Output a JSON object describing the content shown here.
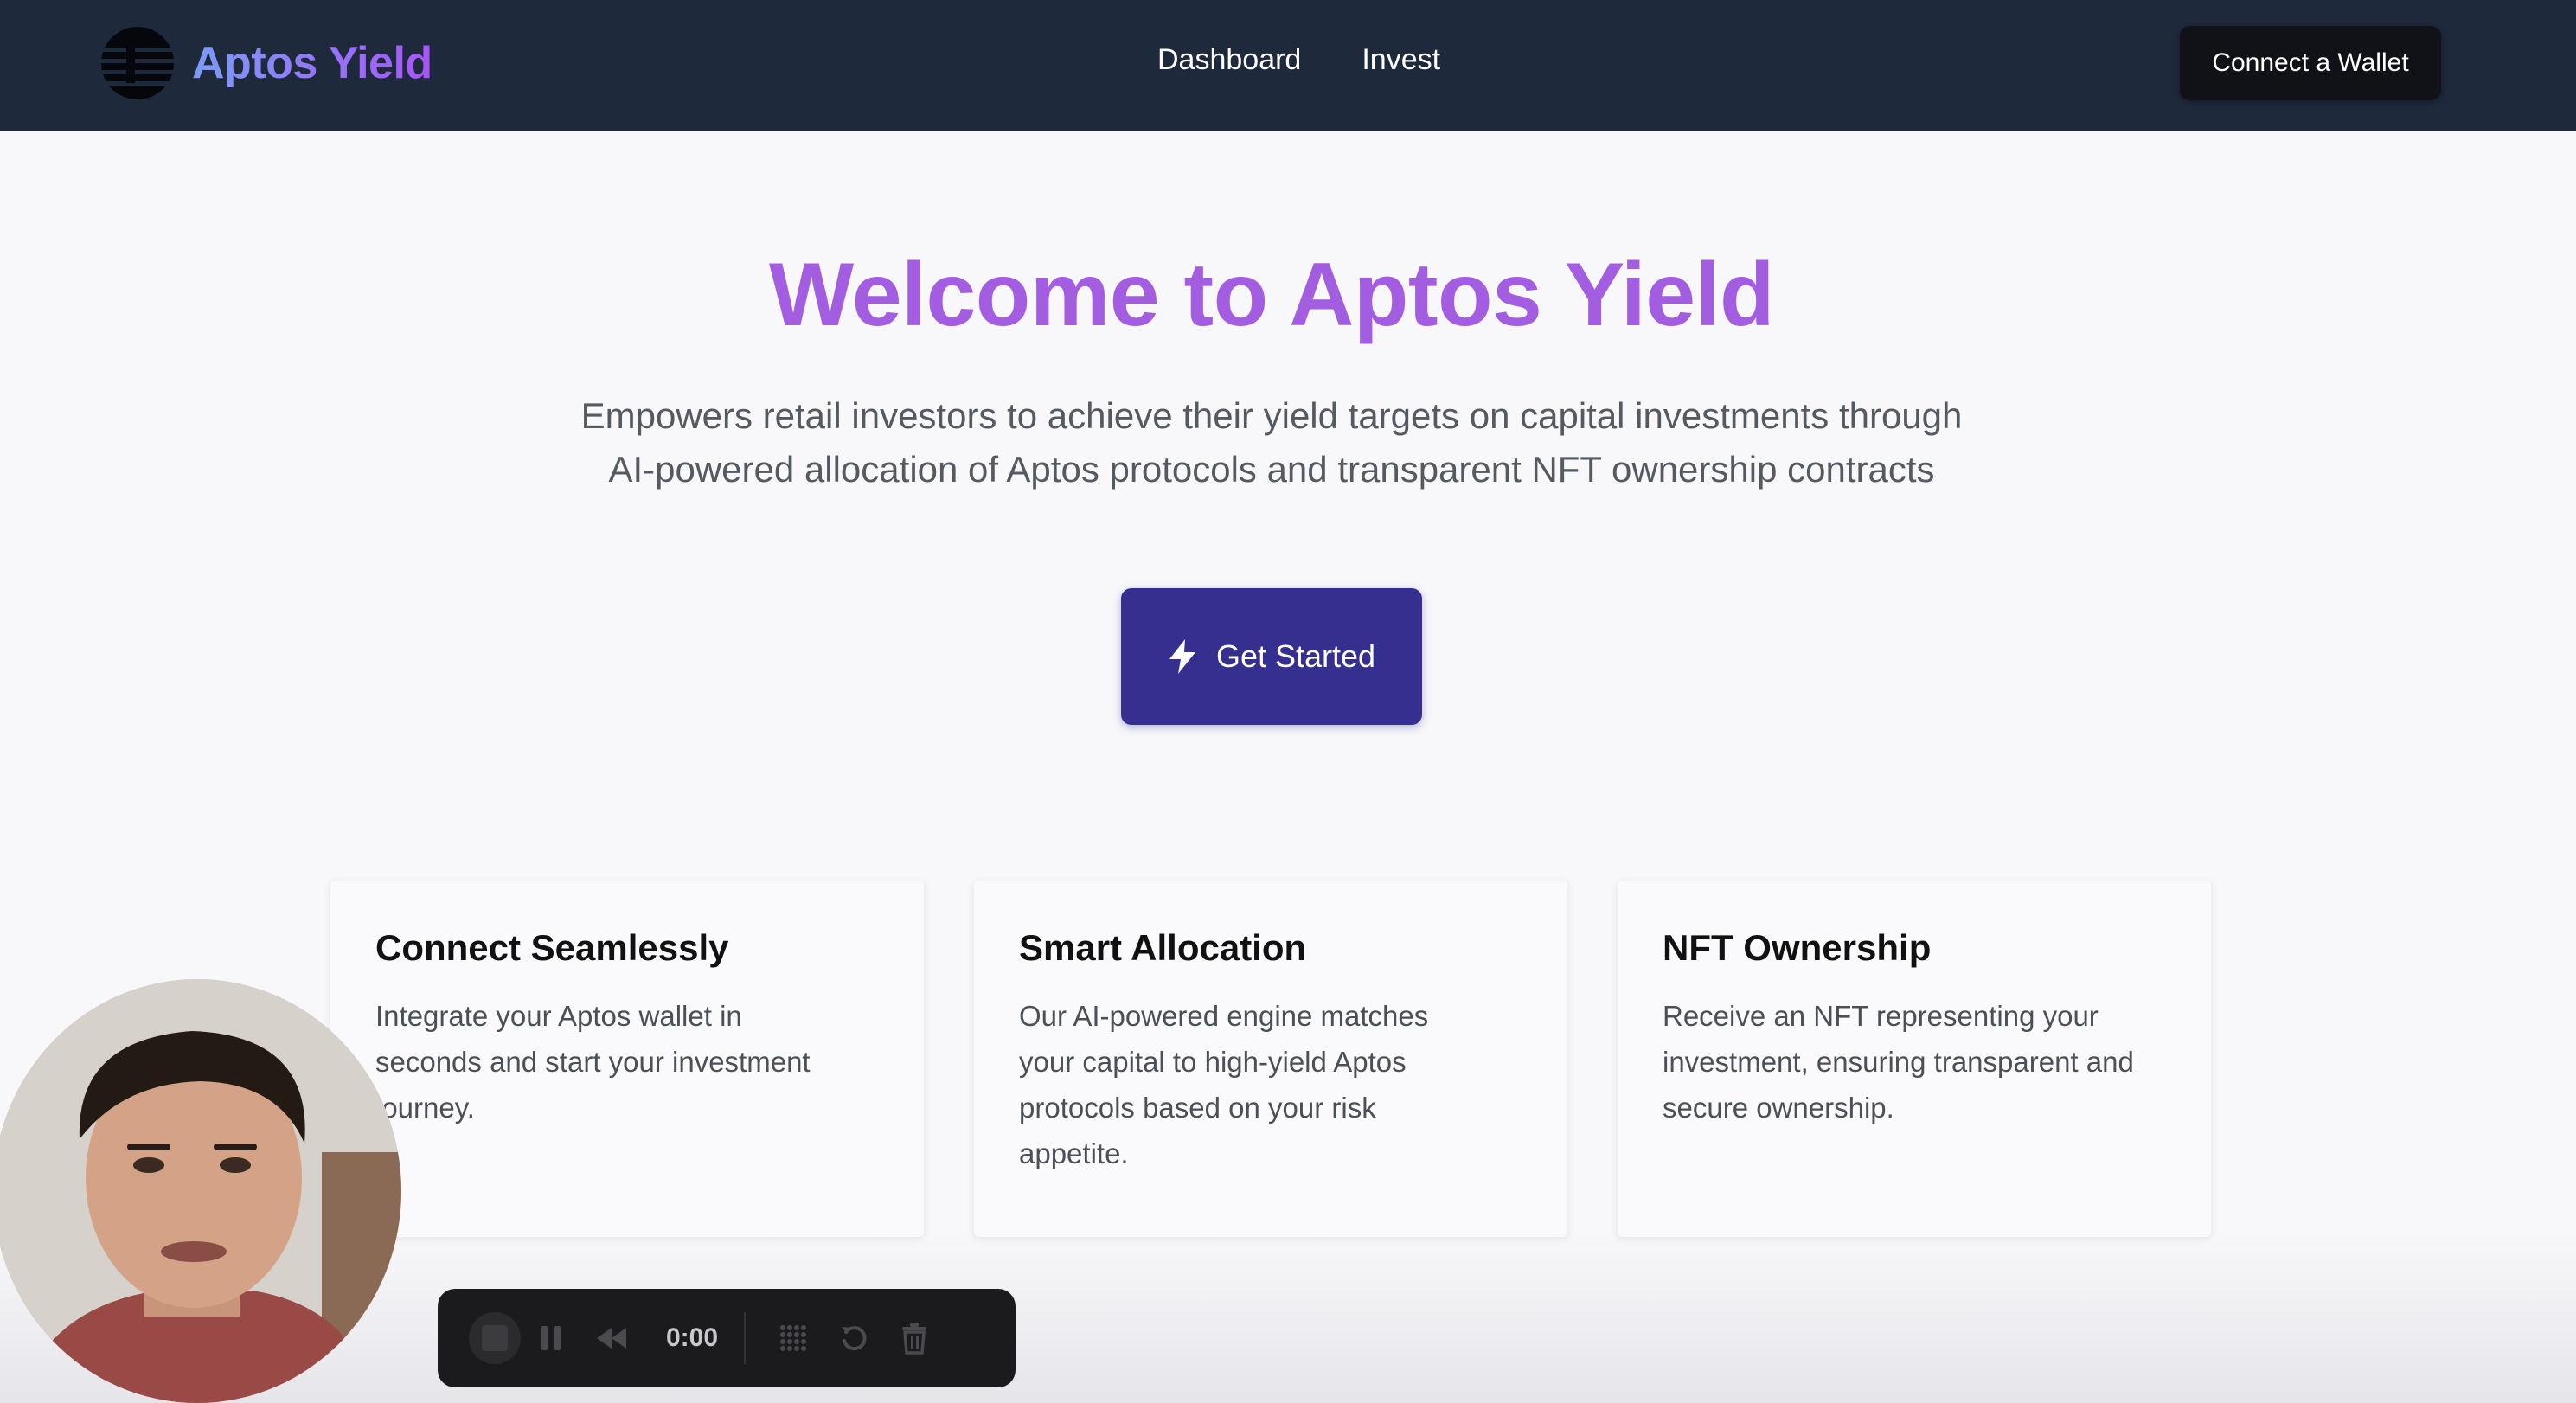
{
  "brand": {
    "name": "Aptos Yield",
    "gradient_start": "#7c9cf5",
    "gradient_end": "#a855f7",
    "logo_icon": "aptos-logo-icon"
  },
  "nav": {
    "links": [
      {
        "label": "Dashboard"
      },
      {
        "label": "Invest"
      }
    ],
    "wallet_button": "Connect a Wallet",
    "background": "#1e293b"
  },
  "hero": {
    "title": "Welcome to Aptos Yield",
    "title_color": "#a35de0",
    "subtitle_line1": "Empowers retail investors to achieve their yield targets on capital investments through",
    "subtitle_line2": "AI-powered allocation of Aptos protocols and transparent NFT ownership contracts",
    "cta_label": "Get Started",
    "cta_icon": "lightning-bolt-icon",
    "cta_color": "#352f8f"
  },
  "features": [
    {
      "title": "Connect Seamlessly",
      "lines": [
        "Integrate your Aptos wallet in",
        "seconds and start your investment",
        "journey."
      ]
    },
    {
      "title": "Smart Allocation",
      "lines": [
        "Our AI-powered engine matches",
        "your capital to high-yield Aptos",
        "protocols based on your risk",
        "appetite."
      ]
    },
    {
      "title": "NFT Ownership",
      "lines": [
        "Receive an NFT representing your",
        "investment, ensuring transparent and",
        "secure ownership."
      ]
    }
  ],
  "recorder": {
    "time": "0:00",
    "icons": [
      "stop-icon",
      "pause-icon",
      "rewind-icon",
      "grid-icon",
      "restart-icon",
      "trash-icon"
    ]
  }
}
